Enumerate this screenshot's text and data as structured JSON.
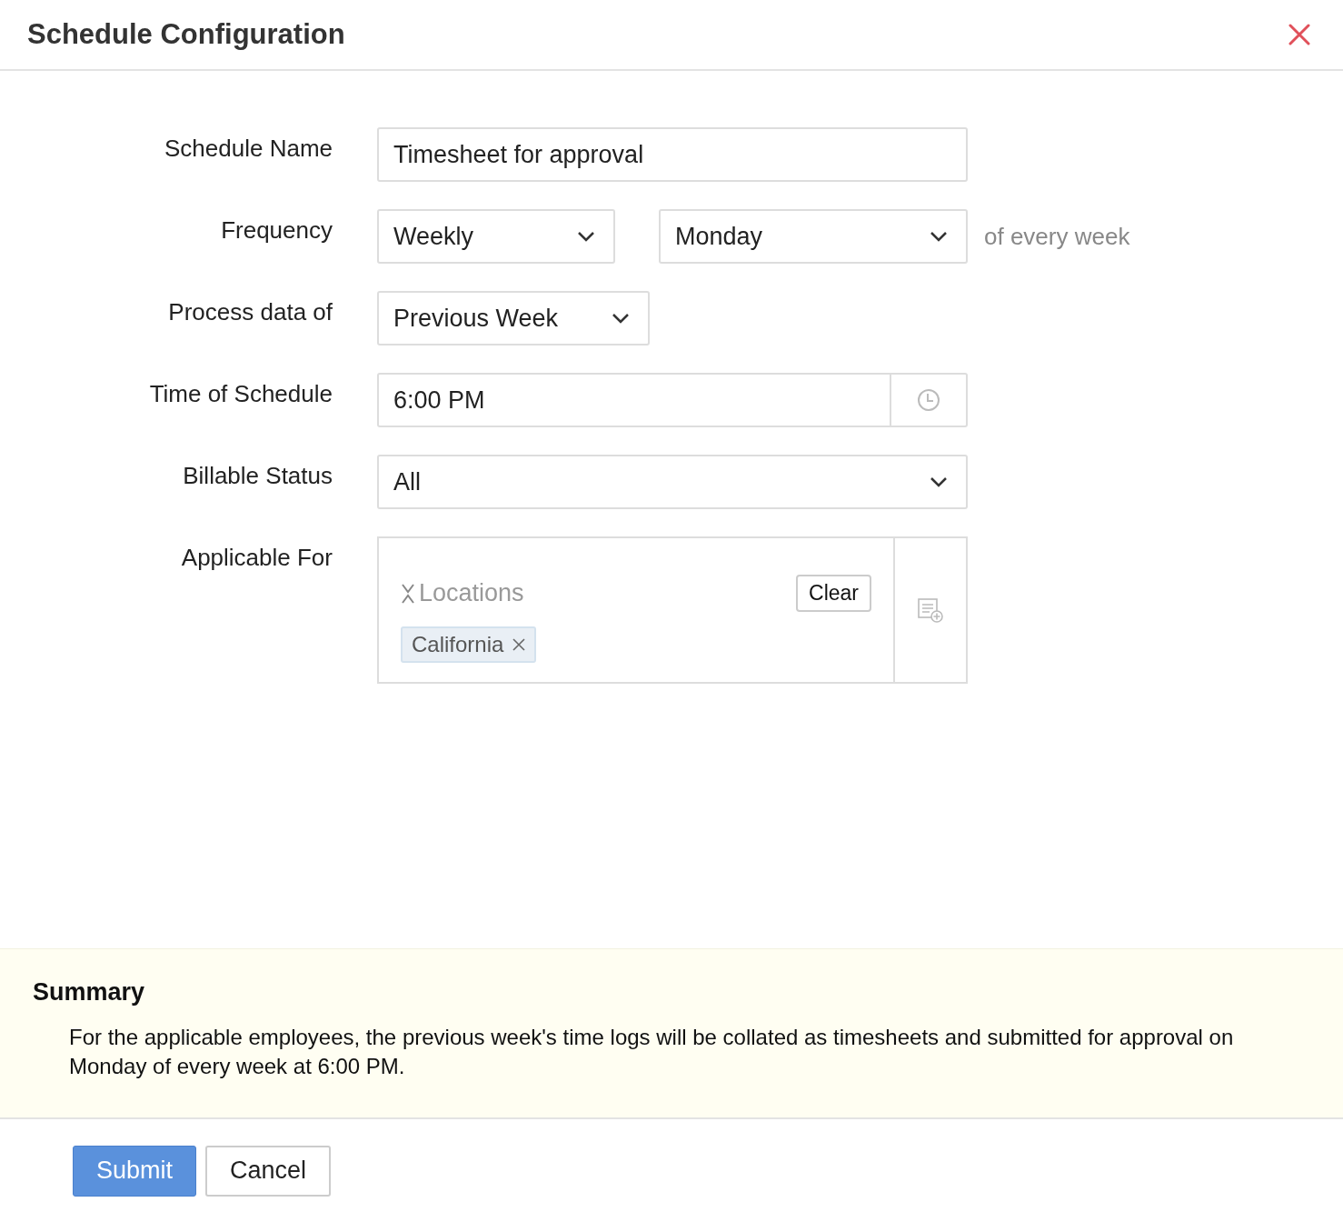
{
  "dialog": {
    "title": "Schedule Configuration"
  },
  "fields": [
    {
      "kind": "text",
      "label": "Schedule Name",
      "value": "Timesheet for approval"
    },
    {
      "kind": "select",
      "label": "Frequency",
      "selects": [
        {
          "value": "Weekly"
        },
        {
          "value": "Monday"
        }
      ],
      "suffix": "of every week"
    },
    {
      "kind": "select",
      "label": "Process data of",
      "selects": [
        {
          "value": "Previous Week"
        }
      ]
    },
    {
      "kind": "time",
      "label": "Time of Schedule",
      "value": "6:00 PM"
    },
    {
      "kind": "select",
      "label": "Billable Status",
      "selects": [
        {
          "value": "All"
        }
      ]
    },
    {
      "kind": "tags",
      "label": "Applicable For",
      "group": "Locations",
      "clear": "Clear",
      "tags": [
        "California"
      ]
    }
  ],
  "summary": {
    "title": "Summary",
    "text": "For the applicable employees, the previous week's time logs will be collated as timesheets and submitted for approval on Monday of every week at 6:00 PM."
  },
  "buttons": [
    {
      "kind": "primary",
      "label": "Submit"
    },
    {
      "kind": "secondary",
      "label": "Cancel"
    }
  ]
}
